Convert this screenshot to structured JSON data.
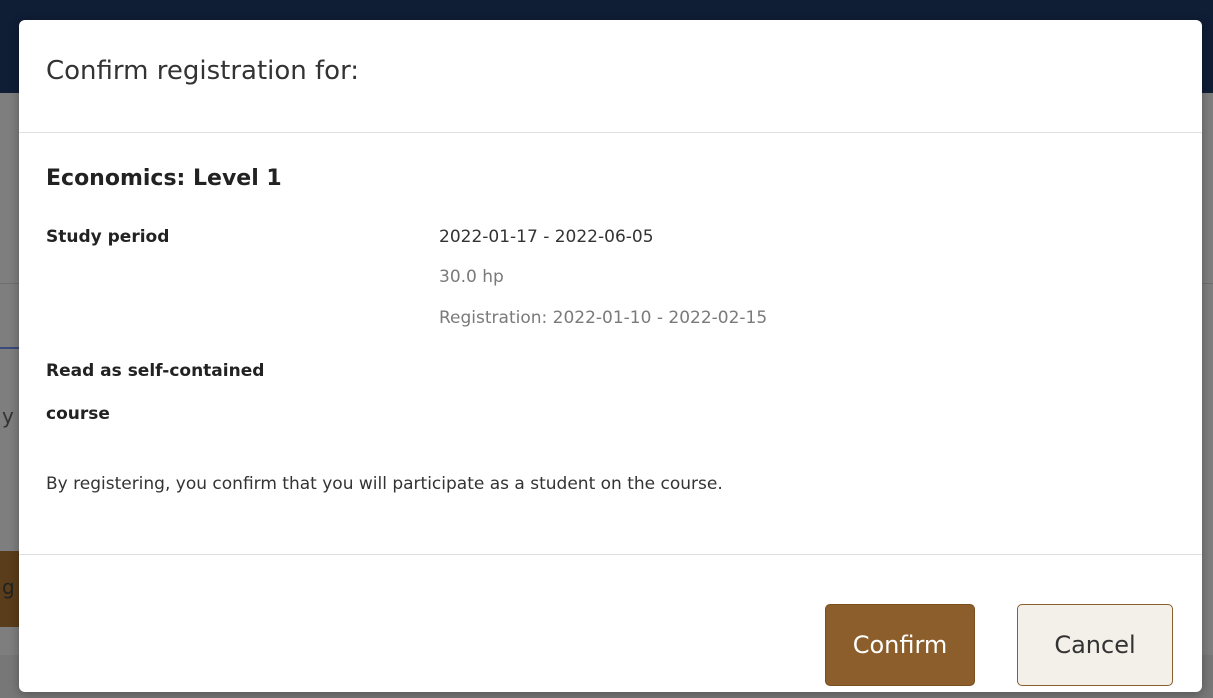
{
  "dialog": {
    "title": "Confirm registration for:",
    "course_name": "Economics: Level 1",
    "study_period_label": "Study period",
    "study_period_dates": "2022-01-17 - 2022-06-05",
    "credits": "30.0 hp",
    "registration_period": "Registration: 2022-01-10 - 2022-02-15",
    "course_type_line1": "Read as self-contained",
    "course_type_line2": "course",
    "consent_text": "By registering, you confirm that you will participate as a student on the course.",
    "confirm_label": "Confirm",
    "cancel_label": "Cancel"
  },
  "background": {
    "glyph_1": "y",
    "glyph_2": "g"
  },
  "colors": {
    "accent": "#8b5e2b",
    "backdrop": "#7e7e7e",
    "header_bg": "#0f1d35"
  }
}
